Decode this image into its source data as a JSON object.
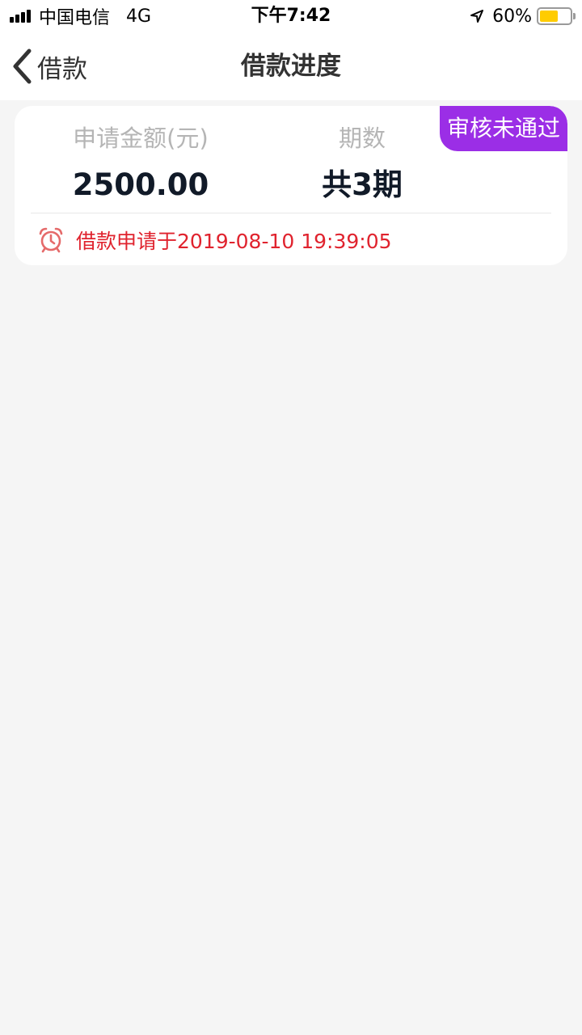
{
  "status_bar": {
    "carrier": "中国电信",
    "network": "4G",
    "time": "下午7:42",
    "battery_percent": "60%",
    "battery_level": 0.6
  },
  "nav": {
    "back_label": "借款",
    "title": "借款进度"
  },
  "loan_card": {
    "status_badge": "审核未通过",
    "amount_label": "申请金额(元)",
    "amount_value": "2500.00",
    "term_label": "期数",
    "term_value": "共3期",
    "apply_text": "借款申请于2019-08-10 19:39:05"
  },
  "colors": {
    "badge_bg": "#9b2ee6",
    "apply_text": "#e0232e",
    "battery_fill": "#ffcc00",
    "page_bg": "#f5f5f5"
  },
  "icons": {
    "signal": "signal-icon",
    "location": "location-arrow-icon",
    "battery": "battery-icon",
    "back": "chevron-left-icon",
    "alarm": "alarm-clock-icon"
  }
}
